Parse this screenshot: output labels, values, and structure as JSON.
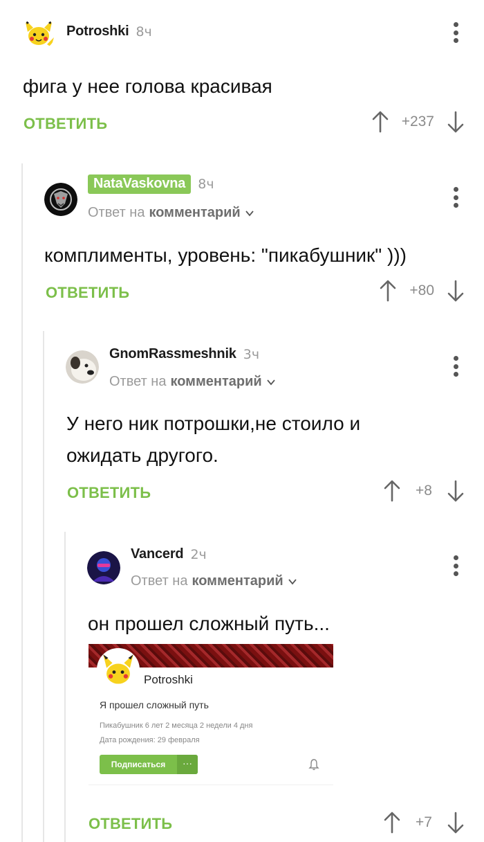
{
  "comments": [
    {
      "username": "Potroshki",
      "time": "8ч",
      "text": "фига у нее голова красивая",
      "reply_label": "ОТВЕТИТЬ",
      "score": "+237"
    },
    {
      "username": "NataVaskovna",
      "time": "8ч",
      "reply_to_prefix": "Ответ на",
      "reply_to_target": "комментарий",
      "text": "комплименты, уровень: \"пикабушник\" )))",
      "reply_label": "ОТВЕТИТЬ",
      "score": "+80"
    },
    {
      "username": "GnomRassmeshnik",
      "time": "3ч",
      "reply_to_prefix": "Ответ на",
      "reply_to_target": "комментарий",
      "text_line1": "У него ник потрошки,не стоило и",
      "text_line2": "ожидать другого.",
      "reply_label": "ОТВЕТИТЬ",
      "score": "+8"
    },
    {
      "username": "Vancerd",
      "time": "2ч",
      "reply_to_prefix": "Ответ на",
      "reply_to_target": "комментарий",
      "text": "он прошел сложный путь...",
      "reply_label": "ОТВЕТИТЬ",
      "score": "+7"
    }
  ],
  "embed": {
    "name": "Potroshki",
    "status": "Я прошел сложный путь",
    "membership": "Пикабушник 6 лет 2 месяца 2 недели 4 дня",
    "birthday": "Дата рождения: 29 февраля",
    "subscribe_label": "Подписаться",
    "more_label": "···"
  },
  "colors": {
    "accent_green": "#7cbf4a",
    "badge_green": "#8ac858",
    "muted_gray": "#9a9a9a"
  },
  "icons": [
    "pikachu-avatar-icon",
    "witcher-medallion-avatar-icon",
    "dog-avatar-icon",
    "neon-avatar-icon",
    "kebab-menu-icon",
    "upvote-arrow-icon",
    "downvote-arrow-icon",
    "chevron-down-icon",
    "bell-icon"
  ]
}
